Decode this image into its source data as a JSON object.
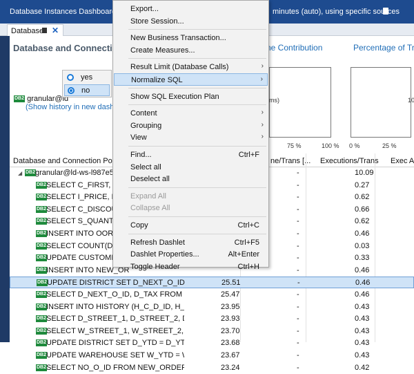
{
  "window": {
    "title_left": "Database Instances Dashboard sho",
    "title_right": "minutes (auto), using specific sources"
  },
  "tab": {
    "label": "Database"
  },
  "section": {
    "title": "Database and Connectio"
  },
  "charts": [
    {
      "title": "ne Contribution",
      "ticks": [
        "ms)",
        "75 %",
        "100 %"
      ]
    },
    {
      "title": "Percentage of Tran",
      "ticks": [
        "0 %",
        "25 %"
      ],
      "side_label": "10"
    }
  ],
  "radio": {
    "options": [
      {
        "label": "yes",
        "selected": false
      },
      {
        "label": "no",
        "selected": true
      }
    ]
  },
  "host": {
    "label": "granular@ld",
    "history": "(Show history in new dashboa"
  },
  "table": {
    "headers": [
      "Database and Connection Pool",
      "ne/Trans [...",
      "Executions/Trans",
      "Exec Av"
    ],
    "rows": [
      {
        "name": "granular@ld-ws-l987e57v...",
        "time": "",
        "tpt": "-",
        "exe": "10.09",
        "top": true
      },
      {
        "name": "SELECT C_FIRST, C_MI",
        "time": "",
        "tpt": "-",
        "exe": "0.27"
      },
      {
        "name": "SELECT I_PRICE, I_NAM",
        "time": "",
        "tpt": "-",
        "exe": "0.62"
      },
      {
        "name": "SELECT C_DISCOUNT,",
        "time": "",
        "tpt": "-",
        "exe": "0.66"
      },
      {
        "name": "SELECT S_QUANTITY,",
        "time": "",
        "tpt": "-",
        "exe": "0.62"
      },
      {
        "name": "INSERT INTO OORDER",
        "time": "",
        "tpt": "-",
        "exe": "0.46"
      },
      {
        "name": "SELECT COUNT(DISTIN",
        "time": "",
        "tpt": "-",
        "exe": "0.03"
      },
      {
        "name": "UPDATE CUSTOMER S",
        "time": "",
        "tpt": "-",
        "exe": "0.33"
      },
      {
        "name": "INSERT INTO NEW_OR",
        "time": "",
        "tpt": "-",
        "exe": "0.46"
      },
      {
        "name": "UPDATE DISTRICT SET D_NEXT_O_ID = D_NE",
        "time": "25.51",
        "tpt": "-",
        "exe": "0.46",
        "selected": true
      },
      {
        "name": "SELECT D_NEXT_O_ID, D_TAX FROM DISTRIC",
        "time": "25.47",
        "tpt": "-",
        "exe": "0.46"
      },
      {
        "name": "INSERT INTO HISTORY (H_C_D_ID, H_C_W_I",
        "time": "23.95",
        "tpt": "-",
        "exe": "0.43"
      },
      {
        "name": "SELECT D_STREET_1, D_STREET_2, D_CITY,",
        "time": "23.93",
        "tpt": "-",
        "exe": "0.43"
      },
      {
        "name": "SELECT W_STREET_1, W_STREET_2, W_CITY,",
        "time": "23.70",
        "tpt": "-",
        "exe": "0.43"
      },
      {
        "name": "UPDATE DISTRICT SET D_YTD = D_YTD + ? W",
        "time": "23.68",
        "tpt": "-",
        "exe": "0.43"
      },
      {
        "name": "UPDATE WAREHOUSE SET W_YTD = W_YTD",
        "time": "23.67",
        "tpt": "-",
        "exe": "0.43"
      },
      {
        "name": "SELECT NO_O_ID FROM NEW_ORDER WHERE",
        "time": "23.24",
        "tpt": "-",
        "exe": "0.42"
      }
    ]
  },
  "menu": {
    "items": [
      {
        "label": "Export..."
      },
      {
        "label": "Store Session..."
      },
      {
        "sep": true
      },
      {
        "label": "New Business Transaction..."
      },
      {
        "label": "Create Measures..."
      },
      {
        "sep": true
      },
      {
        "label": "Result Limit (Database Calls)",
        "submenu": true
      },
      {
        "label": "Normalize SQL",
        "submenu": true,
        "highlighted": true
      },
      {
        "sep": true
      },
      {
        "label": "Show SQL Execution Plan"
      },
      {
        "sep": true
      },
      {
        "label": "Content",
        "submenu": true
      },
      {
        "label": "Grouping",
        "submenu": true
      },
      {
        "label": "View",
        "submenu": true
      },
      {
        "sep": true
      },
      {
        "label": "Find...",
        "shortcut": "Ctrl+F"
      },
      {
        "label": "Select all"
      },
      {
        "label": "Deselect all"
      },
      {
        "sep": true
      },
      {
        "label": "Expand All",
        "disabled": true
      },
      {
        "label": "Collapse All",
        "disabled": true
      },
      {
        "sep": true
      },
      {
        "label": "Copy",
        "shortcut": "Ctrl+C"
      },
      {
        "sep": true
      },
      {
        "label": "Refresh Dashlet",
        "shortcut": "Ctrl+F5"
      },
      {
        "label": "Dashlet Properties...",
        "shortcut": "Alt+Enter"
      },
      {
        "label": "Toggle Header",
        "shortcut": "Ctrl+H"
      }
    ]
  }
}
